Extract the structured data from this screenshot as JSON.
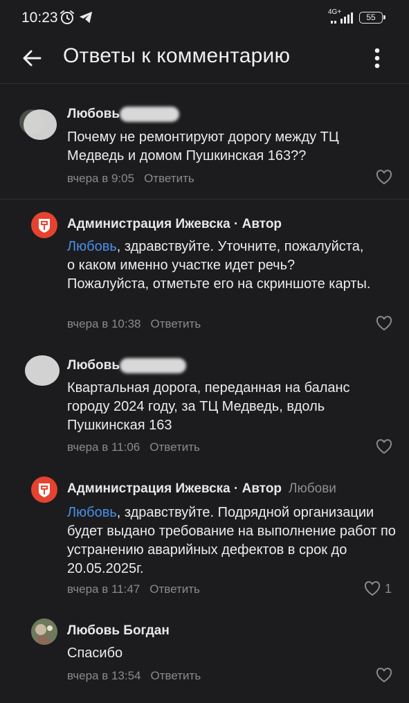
{
  "status": {
    "time": "10:23",
    "network": "4G+",
    "battery": "55"
  },
  "header": {
    "title": "Ответы к комментарию"
  },
  "comments": [
    {
      "author": "Любовь",
      "text": "Почему не ремонтируют дорогу между ТЦ Медведь и домом Пушкинская 163??",
      "time": "вчера в 9:05",
      "reply_label": "Ответить",
      "likes": ""
    },
    {
      "author": "Администрация Ижевска · Автор",
      "mention": "Любовь",
      "text": ", здравствуйте. Уточните, пожалуйста, о каком именно участке идет речь? Пожалуйста, отметьте его на скриншоте карты.",
      "time": "вчера в 10:38",
      "reply_label": "Ответить",
      "likes": ""
    },
    {
      "author": "Любовь",
      "text": "Квартальная дорога, переданная на баланс городу 2024 году, за ТЦ Медведь, вдоль Пушкинская 163",
      "time": "вчера в 11:06",
      "reply_label": "Ответить",
      "likes": ""
    },
    {
      "author": "Администрация Ижевска · Автор",
      "reply_to": "Любови",
      "mention": "Любовь",
      "text": ", здравствуйте. Подрядной организации будет выдано требование на выполнение работ по устранению аварийных дефектов в срок до 20.05.2025г.",
      "time": "вчера в 11:47",
      "reply_label": "Ответить",
      "likes": "1"
    },
    {
      "author": "Любовь Богдан",
      "text": "Спасибо",
      "time": "вчера в 13:54",
      "reply_label": "Ответить",
      "likes": ""
    }
  ],
  "colors": {
    "background": "#1c1c1e",
    "mention": "#4a8fe8",
    "admin_avatar": "#e5432f",
    "muted": "#8a8a8e"
  },
  "icons": [
    "alarm-icon",
    "telegram-icon",
    "signal-icon",
    "battery-icon",
    "back-arrow-icon",
    "more-vert-icon",
    "heart-icon",
    "city-emblem-icon"
  ]
}
